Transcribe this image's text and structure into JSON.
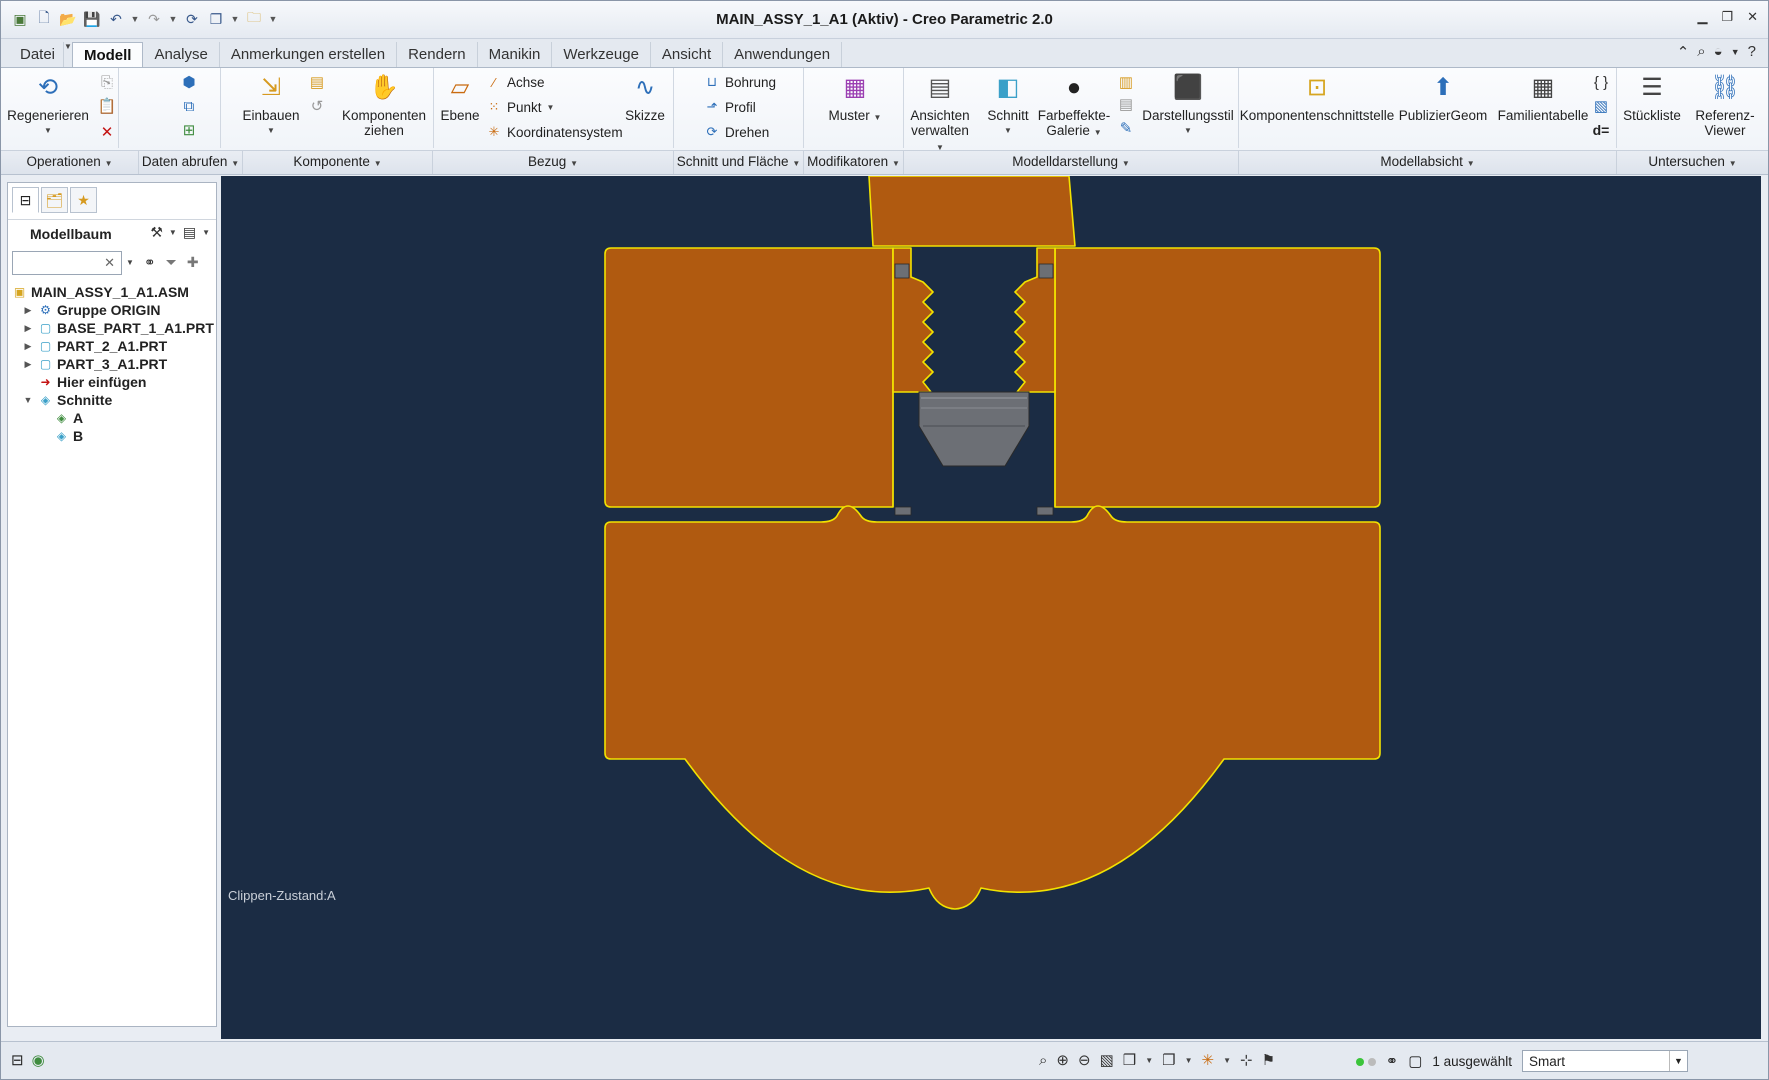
{
  "window": {
    "title": "MAIN_ASSY_1_A1 (Aktiv) - Creo Parametric 2.0"
  },
  "tabs": [
    {
      "label": "Datei",
      "active": false
    },
    {
      "label": "Modell",
      "active": true
    },
    {
      "label": "Analyse",
      "active": false
    },
    {
      "label": "Anmerkungen erstellen",
      "active": false
    },
    {
      "label": "Rendern",
      "active": false
    },
    {
      "label": "Manikin",
      "active": false
    },
    {
      "label": "Werkzeuge",
      "active": false
    },
    {
      "label": "Ansicht",
      "active": false
    },
    {
      "label": "Anwendungen",
      "active": false
    }
  ],
  "ribbon": {
    "regenerate": "Regenerieren",
    "einbauen": "Einbauen",
    "komponenten_ziehen_1": "Komponenten",
    "komponenten_ziehen_2": "ziehen",
    "ebene": "Ebene",
    "achse": "Achse",
    "punkt": "Punkt",
    "koordinatensystem": "Koordinatensystem",
    "skizze": "Skizze",
    "bohrung": "Bohrung",
    "profil": "Profil",
    "drehen": "Drehen",
    "muster": "Muster",
    "ansichten_1": "Ansichten",
    "ansichten_2": "verwalten",
    "schnitt": "Schnitt",
    "farbeffekte_1": "Farbeffekte-",
    "farbeffekte_2": "Galerie",
    "darstellungsstil": "Darstellungsstil",
    "komponentenschnittstelle": "Komponentenschnittstelle",
    "publiziergeom": "PublizierGeom",
    "familientabelle": "Familientabelle",
    "stueckliste": "Stückliste",
    "referenz_1": "Referenz-",
    "referenz_2": "Viewer",
    "d_eq": "d="
  },
  "groups": [
    {
      "label": "Operationen"
    },
    {
      "label": "Daten abrufen"
    },
    {
      "label": "Komponente"
    },
    {
      "label": "Bezug"
    },
    {
      "label": "Schnitt und Fläche"
    },
    {
      "label": "Modifikatoren"
    },
    {
      "label": "Modelldarstellung"
    },
    {
      "label": "Modellabsicht"
    },
    {
      "label": "Untersuchen"
    }
  ],
  "modeltree": {
    "header": "Modellbaum",
    "search_value": "",
    "nodes": [
      {
        "label": "MAIN_ASSY_1_A1.ASM",
        "icon": "assembly-icon"
      },
      {
        "label": "Gruppe ORIGIN",
        "icon": "group-icon"
      },
      {
        "label": "BASE_PART_1_A1.PRT",
        "icon": "part-icon"
      },
      {
        "label": "PART_2_A1.PRT",
        "icon": "part-icon"
      },
      {
        "label": "PART_3_A1.PRT",
        "icon": "part-icon"
      },
      {
        "label": "Hier einfügen",
        "icon": "insert-arrow-icon"
      },
      {
        "label": "Schnitte",
        "icon": "sections-icon"
      },
      {
        "label": "A",
        "icon": "section-active-icon"
      },
      {
        "label": "B",
        "icon": "section-icon"
      }
    ]
  },
  "graphics": {
    "clip_label": "Clippen-Zustand:A",
    "background": "#1b2c44",
    "part_color": "#b05a10",
    "edge_color": "#f2e200",
    "screw_color": "#6c6f75"
  },
  "status": {
    "selected": "1 ausgewählt",
    "filter_value": "Smart"
  }
}
